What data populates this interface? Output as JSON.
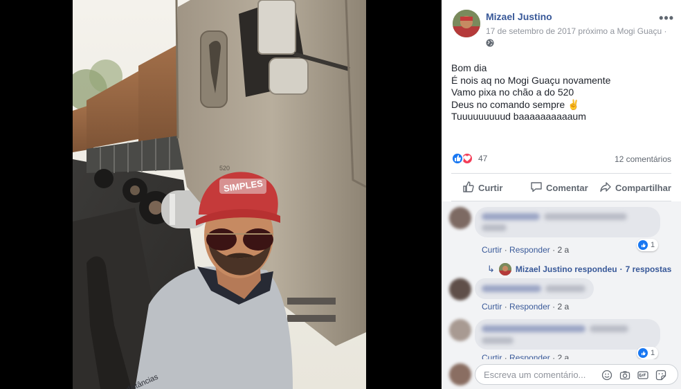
{
  "post": {
    "author": "Mizael Justino",
    "date_line": "17 de setembro de 2017 próximo a Mogi Guaçu ·",
    "privacy_icon": "globe-icon",
    "more_icon": "more-options-icon",
    "text_lines": [
      "Bom dia",
      "É nois aq no Mogi Guaçu novamente",
      "Vamo pixa no chão a do 520",
      "Deus no comando sempre ✌️",
      "Tuuuuuuuuud baaaaaaaaaaum"
    ]
  },
  "photo": {
    "cap_text": "SIMPLES",
    "shirt_text": "distâncias",
    "truck_model": "520"
  },
  "stats": {
    "reactions_count": "47",
    "comments_count": "12 comentários"
  },
  "actions": {
    "like": "Curtir",
    "comment": "Comentar",
    "share": "Compartilhar"
  },
  "comments": [
    {
      "like": "Curtir",
      "sep": "·",
      "reply": "Responder",
      "age": "2 a",
      "reactions": "1"
    },
    {
      "like": "Curtir",
      "sep": "·",
      "reply": "Responder",
      "age": "2 a"
    },
    {
      "like": "Curtir",
      "sep": "·",
      "reply": "Responder",
      "age": "2 a",
      "reactions": "1"
    }
  ],
  "reply_summary": {
    "text": "Mizael Justino respondeu",
    "sep": "·",
    "count": "7 respostas"
  },
  "composer": {
    "placeholder": "Escreva um comentário..."
  },
  "colors": {
    "link": "#385898",
    "like_blue": "#1877f2",
    "love_red": "#f33e58"
  }
}
